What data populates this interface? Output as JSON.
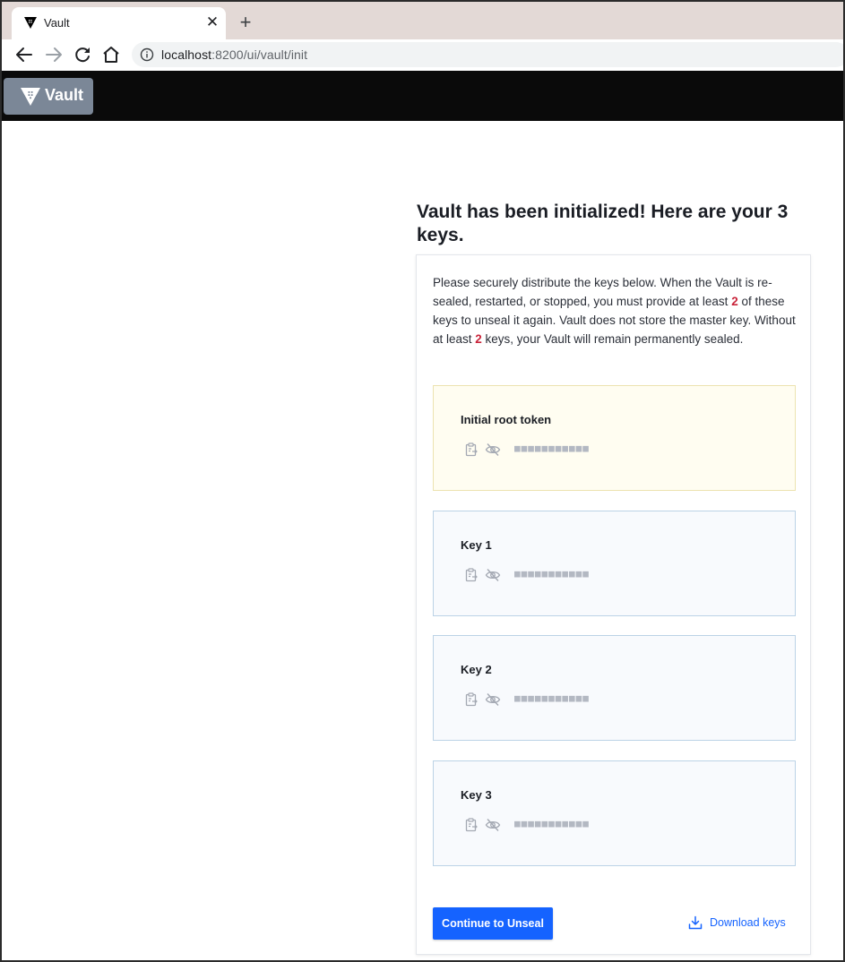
{
  "browser": {
    "tab_title": "Vault",
    "tab_close": "✕",
    "new_tab": "+",
    "url_host": "localhost",
    "url_rest": ":8200/ui/vault/init"
  },
  "navbar": {
    "brand": "Vault"
  },
  "page": {
    "title": "Vault has been initialized! Here are your 3 keys.",
    "intro_part1": "Please securely distribute the keys below. When the Vault is re-sealed, restarted, or stopped, you must provide at least ",
    "threshold": "2",
    "intro_part2": " of these keys to unseal it again. Vault does not store the master key. Without at least ",
    "intro_part3": " keys, your Vault will remain permanently sealed."
  },
  "keys": [
    {
      "label": "Initial root token",
      "masked": "■■■■■■■■■■■"
    },
    {
      "label": "Key 1",
      "masked": "■■■■■■■■■■■"
    },
    {
      "label": "Key 2",
      "masked": "■■■■■■■■■■■"
    },
    {
      "label": "Key 3",
      "masked": "■■■■■■■■■■■"
    }
  ],
  "actions": {
    "continue_label": "Continue to Unseal",
    "download_label": "Download keys"
  },
  "colors": {
    "primary": "#1563ff",
    "threshold_highlight": "#c9243a",
    "root_token_bg": "#fffdf1",
    "key_bg": "#f8fafd",
    "navbar_bg": "#0a0a0a",
    "brand_bg": "#7b8797"
  },
  "icons": {
    "copy": "clipboard-copy-icon",
    "visibility": "eye-off-icon",
    "download": "download-icon"
  }
}
